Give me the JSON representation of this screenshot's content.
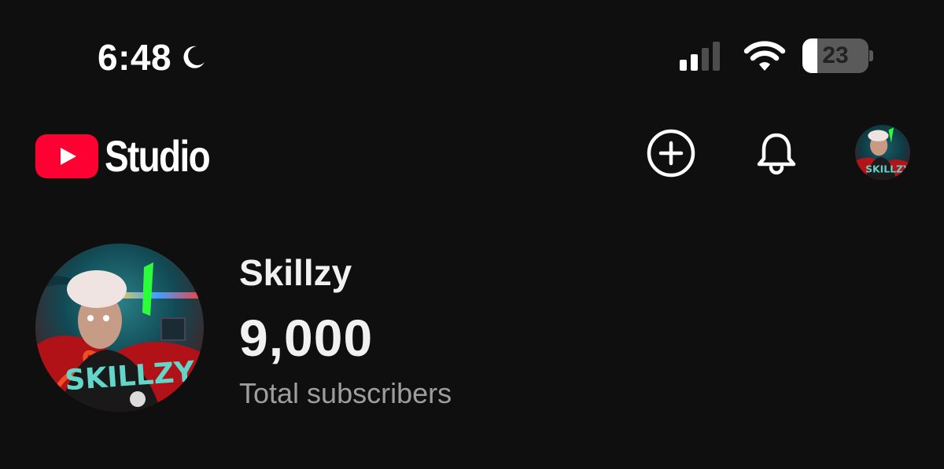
{
  "status_bar": {
    "time": "6:48",
    "focus_icon": "moon-icon",
    "signal_bars_active": 2,
    "signal_bars_total": 4,
    "battery_percent": "23",
    "battery_level": 0.23
  },
  "header": {
    "app_name": "Studio",
    "logo_icon": "youtube-play-icon",
    "actions": [
      {
        "name": "create",
        "icon": "plus-circle-icon"
      },
      {
        "name": "notifications",
        "icon": "bell-icon"
      },
      {
        "name": "account",
        "icon": "avatar-image"
      }
    ]
  },
  "channel": {
    "name": "Skillzy",
    "subscriber_count": "9,000",
    "subscriber_label": "Total subscribers",
    "avatar_text": "SKILLZY"
  },
  "colors": {
    "background": "#0f0f0f",
    "brand_red": "#ff0033",
    "primary_text": "#f1f1f1",
    "secondary_text": "#9e9e9e"
  }
}
